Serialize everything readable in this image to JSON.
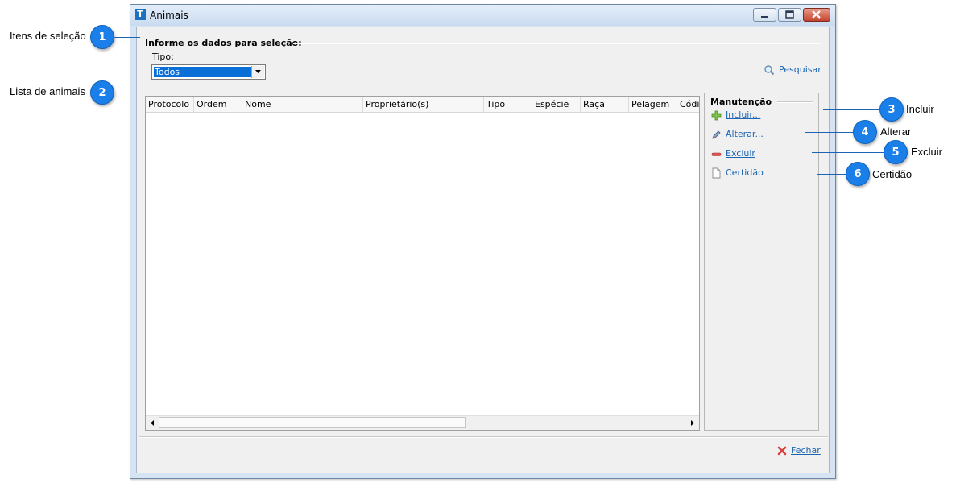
{
  "window": {
    "title": "Animais",
    "app_icon_letter": "T"
  },
  "selection": {
    "group_title": "Informe os dados para seleção:",
    "tipo_label": "Tipo:",
    "tipo_value": "Todos",
    "search_label": "Pesquisar"
  },
  "grid": {
    "columns": [
      "Protocolo",
      "Ordem",
      "Nome",
      "Proprietário(s)",
      "Tipo",
      "Espécie",
      "Raça",
      "Pelagem",
      "Códig"
    ],
    "rows": []
  },
  "maintenance": {
    "title": "Manutenção",
    "include_label": "Incluir...",
    "alter_label": "Alterar...",
    "delete_label": "Excluir",
    "certificate_label": "Certidão"
  },
  "footer": {
    "close_label": "Fechar"
  },
  "callouts": {
    "c1": {
      "number": "1",
      "label": "Itens de seleção"
    },
    "c2": {
      "number": "2",
      "label": "Lista de animais"
    },
    "c3": {
      "number": "3",
      "label": "Incluir"
    },
    "c4": {
      "number": "4",
      "label": "Alterar"
    },
    "c5": {
      "number": "5",
      "label": "Excluir"
    },
    "c6": {
      "number": "6",
      "label": "Certidão"
    }
  },
  "colors": {
    "accent": "#1a7fe8",
    "link": "#1a64b4",
    "selection": "#0a6fd6"
  }
}
